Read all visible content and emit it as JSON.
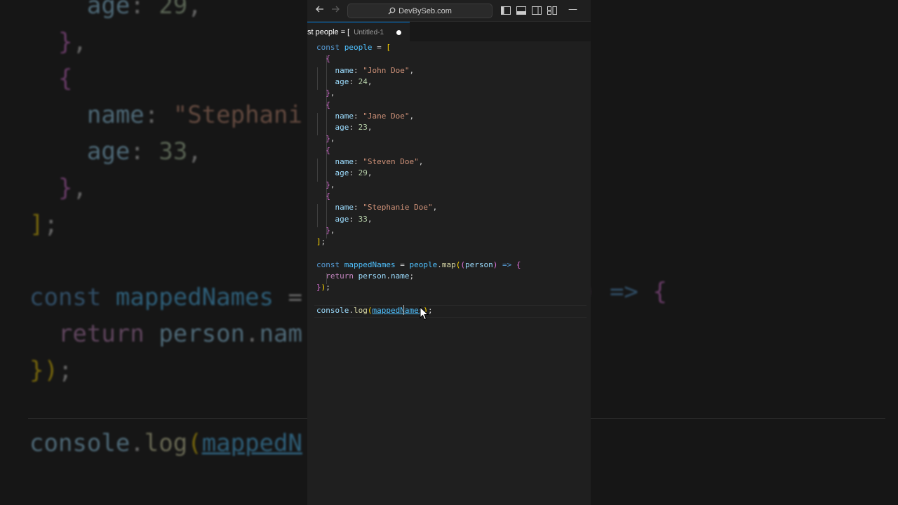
{
  "background_code": {
    "left": [
      {
        "text": "age: 29,",
        "tokens": [
          [
            "    ",
            "plain"
          ],
          [
            "age",
            "prop"
          ],
          [
            ": ",
            "plain"
          ],
          [
            "29",
            "num"
          ],
          [
            ",",
            "plain"
          ]
        ]
      },
      {
        "text": "},",
        "tokens": [
          [
            "  ",
            "plain"
          ],
          [
            "}",
            "b2"
          ],
          [
            ",",
            "plain"
          ]
        ]
      },
      {
        "text": "{",
        "tokens": [
          [
            "  ",
            "plain"
          ],
          [
            "{",
            "b2"
          ]
        ]
      },
      {
        "text": "name: \"Stephani",
        "tokens": [
          [
            "    ",
            "plain"
          ],
          [
            "name",
            "prop"
          ],
          [
            ": ",
            "plain"
          ],
          [
            "\"Stephani",
            "str"
          ]
        ]
      },
      {
        "text": "age: 33,",
        "tokens": [
          [
            "    ",
            "plain"
          ],
          [
            "age",
            "prop"
          ],
          [
            ": ",
            "plain"
          ],
          [
            "33",
            "num"
          ],
          [
            ",",
            "plain"
          ]
        ]
      },
      {
        "text": "},",
        "tokens": [
          [
            "  ",
            "plain"
          ],
          [
            "}",
            "b2"
          ],
          [
            ",",
            "plain"
          ]
        ]
      },
      {
        "text": "];",
        "tokens": [
          [
            "]",
            "b1"
          ],
          [
            ";",
            "plain"
          ]
        ]
      },
      {
        "text": "",
        "tokens": []
      },
      {
        "text": "const mappedNames =",
        "tokens": [
          [
            "const",
            "kw"
          ],
          [
            " ",
            "plain"
          ],
          [
            "mappedNames",
            "var"
          ],
          [
            " =",
            "plain"
          ]
        ]
      },
      {
        "text": "return person.nam",
        "tokens": [
          [
            "  ",
            "plain"
          ],
          [
            "return",
            "ctl"
          ],
          [
            " ",
            "plain"
          ],
          [
            "person",
            "prop"
          ],
          [
            ".",
            "plain"
          ],
          [
            "nam",
            "prop"
          ]
        ]
      },
      {
        "text": "});",
        "tokens": [
          [
            "}",
            "b1"
          ],
          [
            ")",
            "b1"
          ],
          [
            ";",
            "plain"
          ]
        ]
      },
      {
        "text": "",
        "tokens": []
      },
      {
        "text": "console.log(mappedN",
        "tokens": [
          [
            "console",
            "prop"
          ],
          [
            ".",
            "plain"
          ],
          [
            "log",
            "fn"
          ],
          [
            "(",
            "b1"
          ],
          [
            "mappedN",
            "var ul"
          ]
        ]
      }
    ],
    "right": [
      {
        "text": ") => {",
        "tokens": [
          [
            ")",
            "b2"
          ],
          [
            " => ",
            "kw"
          ],
          [
            "{",
            "b2"
          ]
        ]
      }
    ]
  },
  "window": {
    "back_icon": "arrow-left-icon",
    "forward_icon": "arrow-right-icon",
    "search_text": "DevBySeb.com",
    "search_icon": "search-icon",
    "minimize_glyph": "—"
  },
  "tab": {
    "breadcrumb": "st people = [",
    "filename": "Untitled-1",
    "modified": true
  },
  "code": [
    [
      [
        "const",
        "kw"
      ],
      [
        " ",
        "plain"
      ],
      [
        "people",
        "var"
      ],
      [
        " = ",
        "plain"
      ],
      [
        "[",
        "b1"
      ]
    ],
    [
      [
        "  ",
        "plain"
      ],
      [
        "{",
        "b2"
      ]
    ],
    [
      [
        "    ",
        "plain"
      ],
      [
        "name",
        "prop"
      ],
      [
        ": ",
        "plain"
      ],
      [
        "\"John Doe\"",
        "str"
      ],
      [
        ",",
        "plain"
      ]
    ],
    [
      [
        "    ",
        "plain"
      ],
      [
        "age",
        "prop"
      ],
      [
        ": ",
        "plain"
      ],
      [
        "24",
        "num"
      ],
      [
        ",",
        "plain"
      ]
    ],
    [
      [
        "  ",
        "plain"
      ],
      [
        "}",
        "b2"
      ],
      [
        ",",
        "plain"
      ]
    ],
    [
      [
        "  ",
        "plain"
      ],
      [
        "{",
        "b2"
      ]
    ],
    [
      [
        "    ",
        "plain"
      ],
      [
        "name",
        "prop"
      ],
      [
        ": ",
        "plain"
      ],
      [
        "\"Jane Doe\"",
        "str"
      ],
      [
        ",",
        "plain"
      ]
    ],
    [
      [
        "    ",
        "plain"
      ],
      [
        "age",
        "prop"
      ],
      [
        ": ",
        "plain"
      ],
      [
        "23",
        "num"
      ],
      [
        ",",
        "plain"
      ]
    ],
    [
      [
        "  ",
        "plain"
      ],
      [
        "}",
        "b2"
      ],
      [
        ",",
        "plain"
      ]
    ],
    [
      [
        "  ",
        "plain"
      ],
      [
        "{",
        "b2"
      ]
    ],
    [
      [
        "    ",
        "plain"
      ],
      [
        "name",
        "prop"
      ],
      [
        ": ",
        "plain"
      ],
      [
        "\"Steven Doe\"",
        "str"
      ],
      [
        ",",
        "plain"
      ]
    ],
    [
      [
        "    ",
        "plain"
      ],
      [
        "age",
        "prop"
      ],
      [
        ": ",
        "plain"
      ],
      [
        "29",
        "num"
      ],
      [
        ",",
        "plain"
      ]
    ],
    [
      [
        "  ",
        "plain"
      ],
      [
        "}",
        "b2"
      ],
      [
        ",",
        "plain"
      ]
    ],
    [
      [
        "  ",
        "plain"
      ],
      [
        "{",
        "b2"
      ]
    ],
    [
      [
        "    ",
        "plain"
      ],
      [
        "name",
        "prop"
      ],
      [
        ": ",
        "plain"
      ],
      [
        "\"Stephanie Doe\"",
        "str"
      ],
      [
        ",",
        "plain"
      ]
    ],
    [
      [
        "    ",
        "plain"
      ],
      [
        "age",
        "prop"
      ],
      [
        ": ",
        "plain"
      ],
      [
        "33",
        "num"
      ],
      [
        ",",
        "plain"
      ]
    ],
    [
      [
        "  ",
        "plain"
      ],
      [
        "}",
        "b2"
      ],
      [
        ",",
        "plain"
      ]
    ],
    [
      [
        "]",
        "b1"
      ],
      [
        ";",
        "plain"
      ]
    ],
    [],
    [
      [
        "const",
        "kw"
      ],
      [
        " ",
        "plain"
      ],
      [
        "mappedNames",
        "var"
      ],
      [
        " = ",
        "plain"
      ],
      [
        "people",
        "var"
      ],
      [
        ".",
        "plain"
      ],
      [
        "map",
        "fn"
      ],
      [
        "(",
        "b1"
      ],
      [
        "(",
        "b2"
      ],
      [
        "person",
        "prop"
      ],
      [
        ")",
        "b2"
      ],
      [
        " => ",
        "kw"
      ],
      [
        "{",
        "b2"
      ]
    ],
    [
      [
        "  ",
        "plain"
      ],
      [
        "return",
        "ctl"
      ],
      [
        " ",
        "plain"
      ],
      [
        "person",
        "prop"
      ],
      [
        ".",
        "plain"
      ],
      [
        "name",
        "prop"
      ],
      [
        ";",
        "plain"
      ]
    ],
    [
      [
        "}",
        "b2"
      ],
      [
        ")",
        "b1"
      ],
      [
        ";",
        "plain"
      ]
    ],
    [],
    [
      [
        "console",
        "prop"
      ],
      [
        ".",
        "plain"
      ],
      [
        "log",
        "fn"
      ],
      [
        "(",
        "b1"
      ],
      [
        "mappedNames",
        "var ul"
      ],
      [
        ")",
        "b1"
      ],
      [
        ";",
        "plain"
      ]
    ]
  ],
  "colors": {
    "editor_bg": "#1f1f1f",
    "keyword": "#569cd6",
    "string": "#ce9178",
    "number": "#b5cea8",
    "property": "#9cdcfe",
    "function": "#dcdcaa",
    "accent": "#0078d4"
  }
}
